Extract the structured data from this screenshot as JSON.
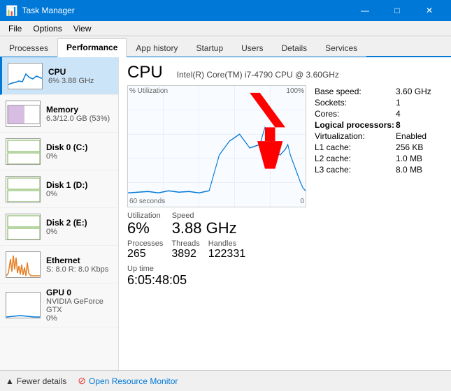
{
  "titlebar": {
    "title": "Task Manager",
    "icon": "🖥",
    "minimize": "—",
    "maximize": "□",
    "close": "✕"
  },
  "menubar": {
    "items": [
      "File",
      "Options",
      "View"
    ]
  },
  "tabs": [
    {
      "label": "Processes",
      "active": false
    },
    {
      "label": "Performance",
      "active": true
    },
    {
      "label": "App history",
      "active": false
    },
    {
      "label": "Startup",
      "active": false
    },
    {
      "label": "Users",
      "active": false
    },
    {
      "label": "Details",
      "active": false
    },
    {
      "label": "Services",
      "active": false
    }
  ],
  "sidebar": {
    "items": [
      {
        "name": "CPU",
        "value": "6%  3.88 GHz",
        "type": "cpu",
        "active": true
      },
      {
        "name": "Memory",
        "value": "6.3/12.0 GB (53%)",
        "type": "mem",
        "active": false
      },
      {
        "name": "Disk 0 (C:)",
        "value": "0%",
        "type": "disk0",
        "active": false
      },
      {
        "name": "Disk 1 (D:)",
        "value": "0%",
        "type": "disk1",
        "active": false
      },
      {
        "name": "Disk 2 (E:)",
        "value": "0%",
        "type": "disk2",
        "active": false
      },
      {
        "name": "Ethernet",
        "value": "S: 8.0  R: 8.0 Kbps",
        "type": "eth",
        "active": false
      },
      {
        "name": "GPU 0",
        "value": "NVIDIA GeForce GTX\n0%",
        "type": "gpu",
        "active": false
      }
    ]
  },
  "content": {
    "title": "CPU",
    "model": "Intel(R) Core(TM) i7-4790 CPU @ 3.60GHz",
    "chart": {
      "y_label": "% Utilization",
      "y_max": "100%",
      "x_left": "60 seconds",
      "x_right": "0"
    },
    "stats": {
      "utilization_label": "Utilization",
      "utilization_value": "6%",
      "speed_label": "Speed",
      "speed_value": "3.88 GHz",
      "processes_label": "Processes",
      "processes_value": "265",
      "threads_label": "Threads",
      "threads_value": "3892",
      "handles_label": "Handles",
      "handles_value": "122331",
      "uptime_label": "Up time",
      "uptime_value": "6:05:48:05"
    },
    "specs": {
      "base_speed_label": "Base speed:",
      "base_speed_value": "3.60 GHz",
      "sockets_label": "Sockets:",
      "sockets_value": "1",
      "cores_label": "Cores:",
      "cores_value": "4",
      "logical_label": "Logical processors:",
      "logical_value": "8",
      "virt_label": "Virtualization:",
      "virt_value": "Enabled",
      "l1_label": "L1 cache:",
      "l1_value": "256 KB",
      "l2_label": "L2 cache:",
      "l2_value": "1.0 MB",
      "l3_label": "L3 cache:",
      "l3_value": "8.0 MB"
    }
  },
  "bottombar": {
    "fewer_label": "Fewer details",
    "open_rm_label": "Open Resource Monitor"
  }
}
